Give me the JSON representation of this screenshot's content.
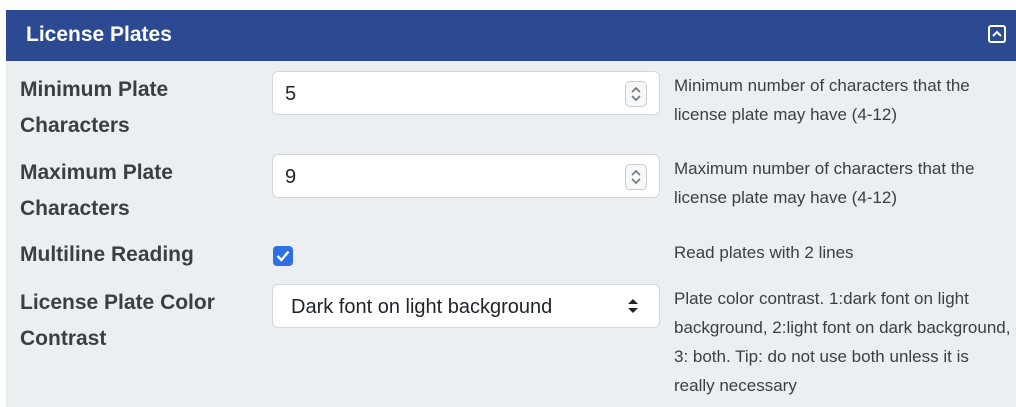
{
  "panel": {
    "title": "License Plates",
    "collapse_icon": "collapse-icon"
  },
  "rows": [
    {
      "label": "Minimum Plate Characters",
      "type": "number",
      "value": "5",
      "help": "Minimum number of characters that the license plate may have (4-12)"
    },
    {
      "label": "Maximum Plate Characters",
      "type": "number",
      "value": "9",
      "help": "Maximum number of characters that the license plate may have (4-12)"
    },
    {
      "label": "Multiline Reading",
      "type": "checkbox",
      "checked": true,
      "help": "Read plates with 2 lines"
    },
    {
      "label": "License Plate Color Contrast",
      "type": "select",
      "value": "Dark font on light background",
      "help": "Plate color contrast. 1:dark font on light background, 2:light font on dark background, 3: both. Tip: do not use both unless it is really necessary"
    }
  ],
  "colors": {
    "header_bg": "#2b4a91",
    "panel_bg": "#eceff1",
    "checkbox_accent": "#2f6fe4"
  }
}
